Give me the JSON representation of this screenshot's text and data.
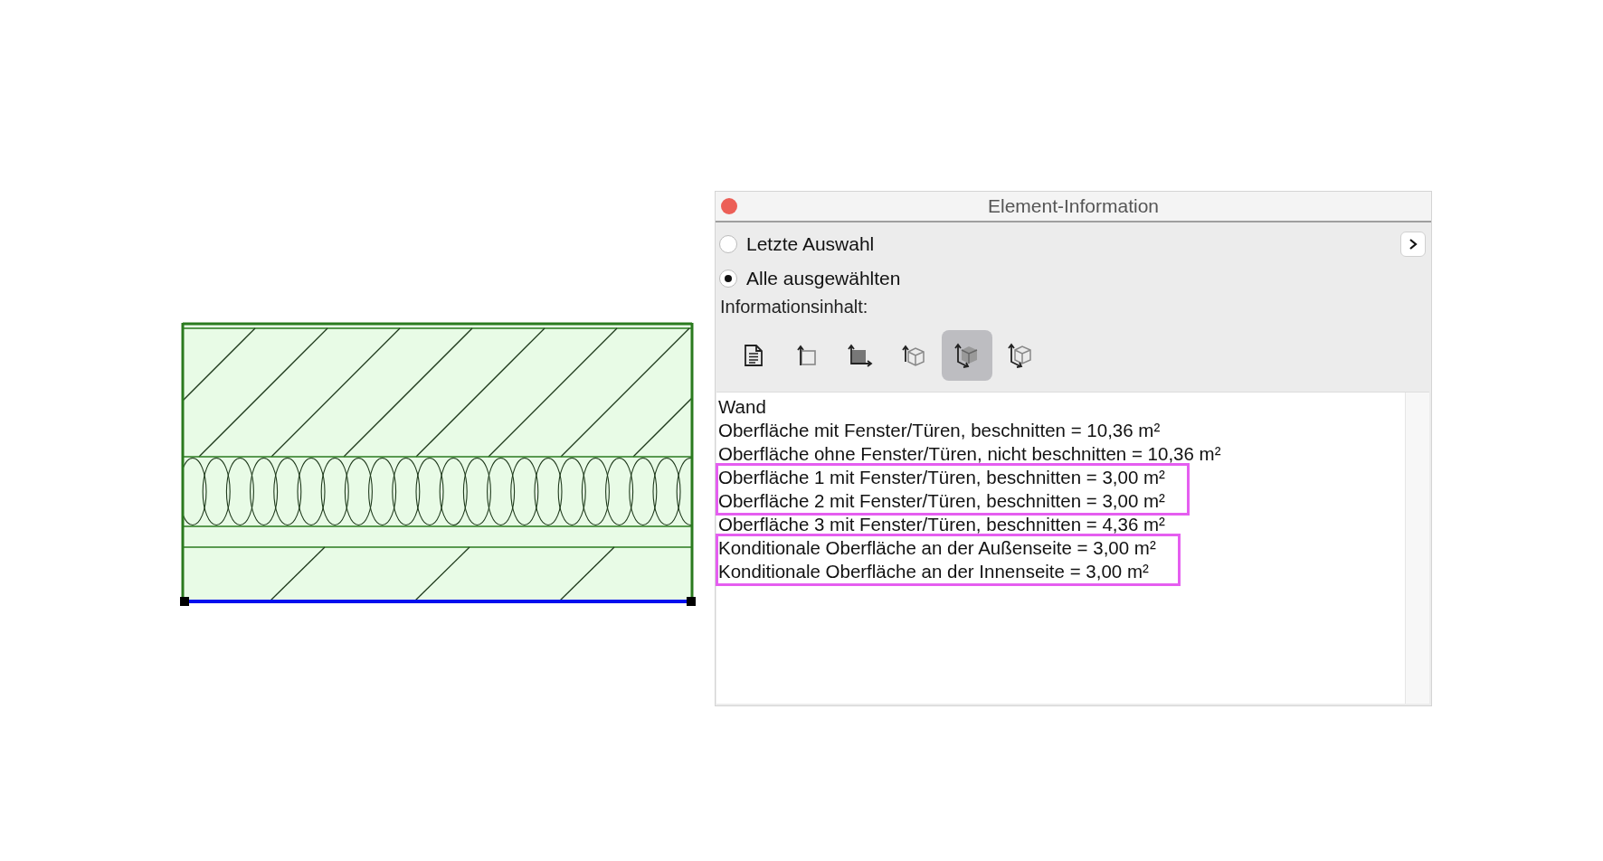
{
  "window": {
    "title": "Element-Information"
  },
  "selection_options": [
    {
      "label": "Letzte Auswahl",
      "selected": false
    },
    {
      "label": "Alle ausgewählten",
      "selected": true
    }
  ],
  "content_label": "Informationsinhalt:",
  "content_buttons": [
    {
      "kind": "document",
      "selected": false
    },
    {
      "kind": "face",
      "selected": false
    },
    {
      "kind": "filledface",
      "selected": false
    },
    {
      "kind": "cube",
      "selected": false
    },
    {
      "kind": "shadedcube",
      "selected": true
    },
    {
      "kind": "wirecube",
      "selected": false
    }
  ],
  "info_blocks": [
    {
      "highlighted": false,
      "lines": [
        "Wand",
        "Oberfläche mit Fenster/Türen, beschnitten = 10,36 m²",
        "Oberfläche ohne Fenster/Türen, nicht beschnitten = 10,36 m²"
      ]
    },
    {
      "highlighted": true,
      "lines": [
        "Oberfläche 1 mit Fenster/Türen, beschnitten = 3,00 m²",
        "Oberfläche 2 mit Fenster/Türen, beschnitten = 3,00 m²"
      ]
    },
    {
      "highlighted": false,
      "lines": [
        "Oberfläche 3 mit Fenster/Türen, beschnitten = 4,36 m²"
      ]
    },
    {
      "highlighted": true,
      "lines": [
        "Konditionale Oberfläche an der Außenseite = 3,00 m²",
        "Konditionale Oberfläche an der Innenseite = 3,00 m²"
      ]
    }
  ]
}
